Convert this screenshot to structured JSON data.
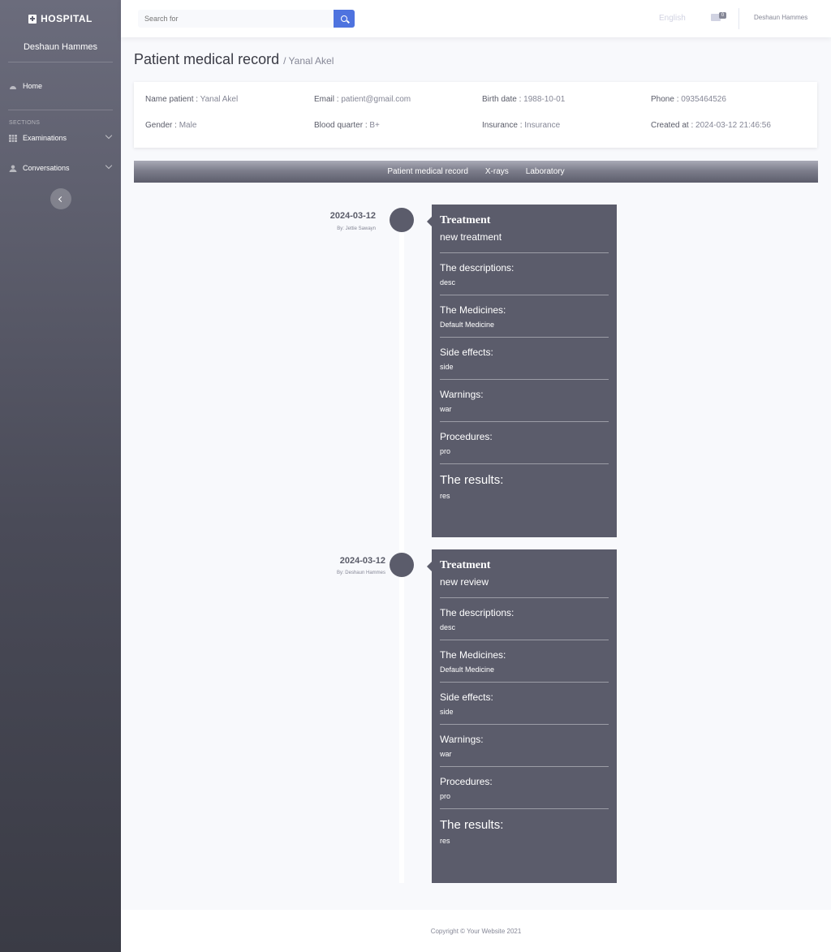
{
  "sidebar": {
    "brand": "HOSPITAL",
    "user_name": "Deshaun Hammes",
    "home_label": "Home",
    "section_heading": "SECTIONS",
    "items": [
      {
        "label": "Examinations"
      },
      {
        "label": "Conversations"
      }
    ]
  },
  "topbar": {
    "search_placeholder": "Search for",
    "language": "English",
    "mail_count": "0",
    "user_name": "Deshaun Hammes"
  },
  "page": {
    "title": "Patient medical record",
    "subtitle": "/ Yanal Akel"
  },
  "patient": {
    "name_label": "Name patient :",
    "name": "Yanal Akel",
    "email_label": "Email :",
    "email": "patient@gmail.com",
    "birth_label": "Birth date :",
    "birth": "1988-10-01",
    "phone_label": "Phone :",
    "phone": "0935464526",
    "gender_label": "Gender :",
    "gender": "Male",
    "blood_label": "Blood quarter :",
    "blood": "B+",
    "insurance_label": "Insurance :",
    "insurance": "Insurance",
    "created_label": "Created at :",
    "created": "2024-03-12 21:46:56"
  },
  "tabs": [
    "Patient medical record",
    "X-rays",
    "Laboratory"
  ],
  "labels": {
    "treatment": "Treatment",
    "descriptions": "The descriptions:",
    "medicines": "The Medicines:",
    "side_effects": "Side effects:",
    "warnings": "Warnings:",
    "procedures": "Procedures:",
    "results": "The results:"
  },
  "entries": [
    {
      "date": "2024-03-12",
      "by": "By: Jettie Sawayn",
      "subtitle": "new treatment",
      "descriptions": "desc",
      "medicines": "Default Medicine",
      "side_effects": "side",
      "warnings": "war",
      "procedures": "pro",
      "results": "res"
    },
    {
      "date": "2024-03-12",
      "by": "By: Deshaun Hammes",
      "subtitle": "new review",
      "descriptions": "desc",
      "medicines": "Default Medicine",
      "side_effects": "side",
      "warnings": "war",
      "procedures": "pro",
      "results": "res"
    }
  ],
  "footer": {
    "copyright": "Copyright © Your Website 2021"
  }
}
